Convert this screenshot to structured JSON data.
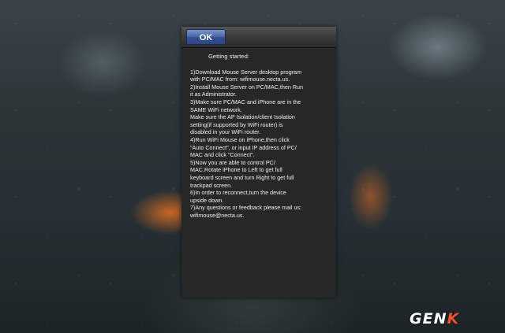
{
  "dialog": {
    "ok_label": "OK",
    "heading": "Getting started:",
    "lines": [
      "1)Download Mouse Server desktop program",
      "with PC/MAC from: wifimouse.necta.us.",
      "2)Install Mouse Server on PC/MAC,then Run",
      "it as Administrator.",
      "3)Make sure PC/MAC and iPhone are in the",
      "SAME WiFi network.",
      "Make sure the AP Isolation/client Isolation",
      "setting(if supported by WiFi router) is",
      "disabled in your WiFi router.",
      "4)Run WiFi Mouse on iPhone,then click",
      "\"Auto Connect\", or input IP address of PC/",
      "MAC and click \"Connect\".",
      "5)Now you are able to control PC/",
      "MAC.Rotate iPhone to Left to get full",
      "keyboard screen and turn Right to get full",
      "trackpad screen.",
      "6)In order to reconnect,turn the device",
      "upside down.",
      "7)Any questions or feedback please mail us:",
      "wifimouse@necta.us."
    ]
  },
  "watermark": {
    "main": "GEN",
    "accent": "K"
  },
  "colors": {
    "ok_button": "#4b66a8",
    "dialog_bg": "#272727",
    "watermark_accent": "#f2522d"
  }
}
